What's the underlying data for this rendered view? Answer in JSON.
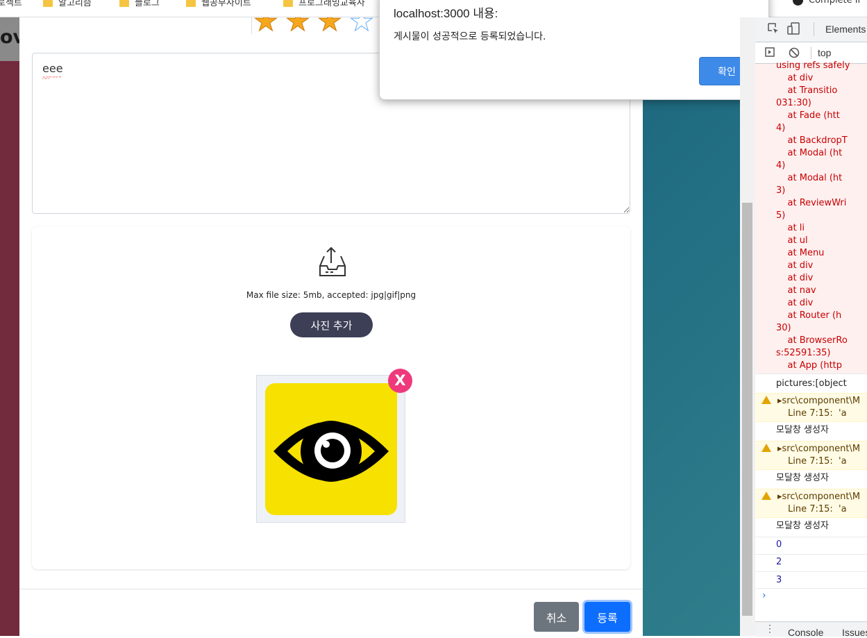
{
  "bookmarks": [
    {
      "label": "로젝트"
    },
    {
      "label": "알고리즘"
    },
    {
      "label": "블로그"
    },
    {
      "label": "웹공부사이트"
    },
    {
      "label": "프로그래밍교육사"
    },
    {
      "label": "Complete Ir"
    }
  ],
  "page": {
    "left_text": "ov",
    "rating": {
      "filled": 3,
      "visible_total": 4
    },
    "review_text": "eee",
    "upload": {
      "hint": "Max file size: 5mb, accepted: jpg|gif|png",
      "add_button": "사진 추가",
      "delete_label": "X"
    },
    "footer": {
      "cancel": "취소",
      "submit": "등록"
    }
  },
  "alert": {
    "title": "localhost:3000 내용:",
    "message": "게시물이 성공적으로 등록되었습니다.",
    "ok": "확인"
  },
  "devtools": {
    "tab_elements": "Elements",
    "context": "top",
    "stack_lines": [
      "using refs safely",
      "    at div",
      "    at Transitio",
      "031:30)",
      "    at Fade (htt",
      "4)",
      "    at BackdropT",
      "    at Modal (ht",
      "4)",
      "    at Modal (ht",
      "3)",
      "    at ReviewWri",
      "5)",
      "    at li",
      "    at ul",
      "    at Menu",
      "    at div",
      "    at div",
      "    at nav",
      "    at div",
      "    at Router (h",
      "30)",
      "    at BrowserRo",
      "s:52591:35)",
      "    at App (http"
    ],
    "pictures_log": "pictures:[object",
    "warnings": [
      {
        "file": "src\\component\\M",
        "detail": "Line 7:15:  'a"
      },
      {
        "file": "src\\component\\M",
        "detail": "Line 7:15:  'a"
      },
      {
        "file": "src\\component\\M",
        "detail": "Line 7:15:  'a"
      }
    ],
    "modal_log": "모달창 생성자",
    "numbers": [
      "0",
      "2",
      "3"
    ],
    "bottom_tab_console": "Console",
    "bottom_tab_issues": "Issues"
  }
}
